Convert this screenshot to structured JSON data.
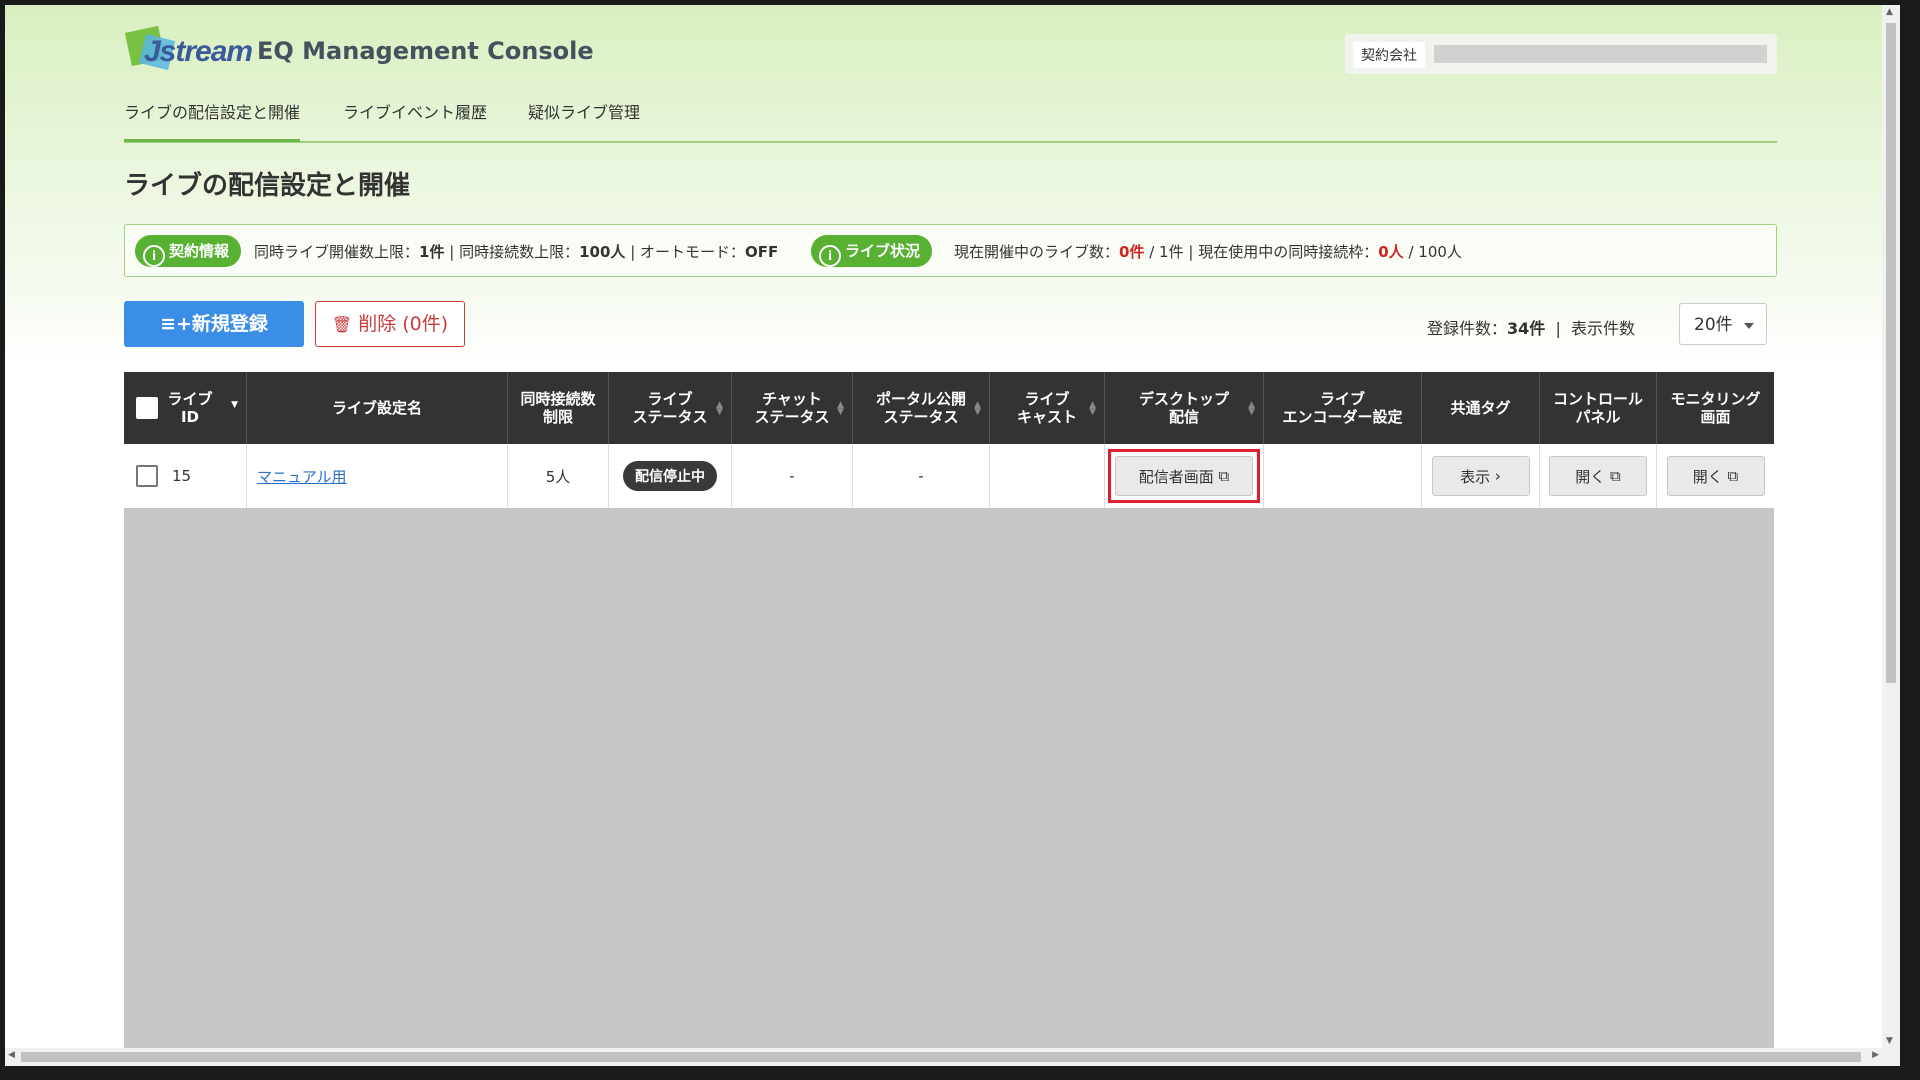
{
  "header": {
    "logo_text": "Jstream",
    "app_title": "EQ Management Console",
    "contract_label": "契約会社"
  },
  "nav": {
    "items": [
      "ライブの配信設定と開催",
      "ライブイベント履歴",
      "疑似ライブ管理"
    ],
    "active_index": 0
  },
  "page_title": "ライブの配信設定と開催",
  "info": {
    "contract_pill": "契約情報",
    "concurrent_live_label": "同時ライブ開催数上限：",
    "concurrent_live_value": "1件",
    "concurrent_conn_label": "同時接続数上限：",
    "concurrent_conn_value": "100人",
    "auto_mode_label": "オートモード：",
    "auto_mode_value": "OFF",
    "status_pill": "ライブ状況",
    "current_live_label": "現在開催中のライブ数：",
    "current_live_value": "0件",
    "current_live_total": "/ 1件",
    "current_conn_label": "現在使用中の同時接続枠：",
    "current_conn_value": "0人",
    "current_conn_total": "/ 100人",
    "separator": "|",
    "info_glyph": "i"
  },
  "toolbar": {
    "new_button": "新規登録",
    "new_icon_glyph": "≡+",
    "delete_button": "削除 (0件)",
    "delete_icon_glyph": "🗑",
    "total_label": "登録件数：",
    "total_value": "34件",
    "separator": "|",
    "display_label": "表示件数",
    "display_value": "20件"
  },
  "table": {
    "headers": {
      "live_id": "ライブ\nID",
      "name": "ライブ設定名",
      "concurrent": "同時接続数\n制限",
      "live_status": "ライブ\nステータス",
      "chat_status": "チャット\nステータス",
      "portal_status": "ポータル公開\nステータス",
      "livecast": "ライブ\nキャスト",
      "desktop": "デスクトップ\n配信",
      "encoder": "ライブ\nエンコーダー設定",
      "common_tag": "共通タグ",
      "control_panel": "コントロール\nパネル",
      "monitoring": "モニタリング\n画面"
    },
    "sort_glyph_up": "▲",
    "sort_glyph_down": "▼",
    "rows": [
      {
        "id": "15",
        "name": "マニュアル用",
        "concurrent": "5人",
        "live_status": "配信停止中",
        "chat_status": "-",
        "portal_status": "-",
        "livecast": "",
        "desktop_button": "配信者画面",
        "encoder": "",
        "common_tag_button": "表示",
        "control_panel_button": "開く",
        "monitoring_button": "開く"
      }
    ]
  },
  "icons": {
    "external_link_glyph": "⧉",
    "chevron_right_glyph": "›"
  },
  "colors": {
    "accent_green": "#58b133",
    "primary_blue": "#3b8ee6",
    "danger_red": "#c93d3d",
    "highlight_red": "#e0202a",
    "header_dark": "#333333"
  }
}
